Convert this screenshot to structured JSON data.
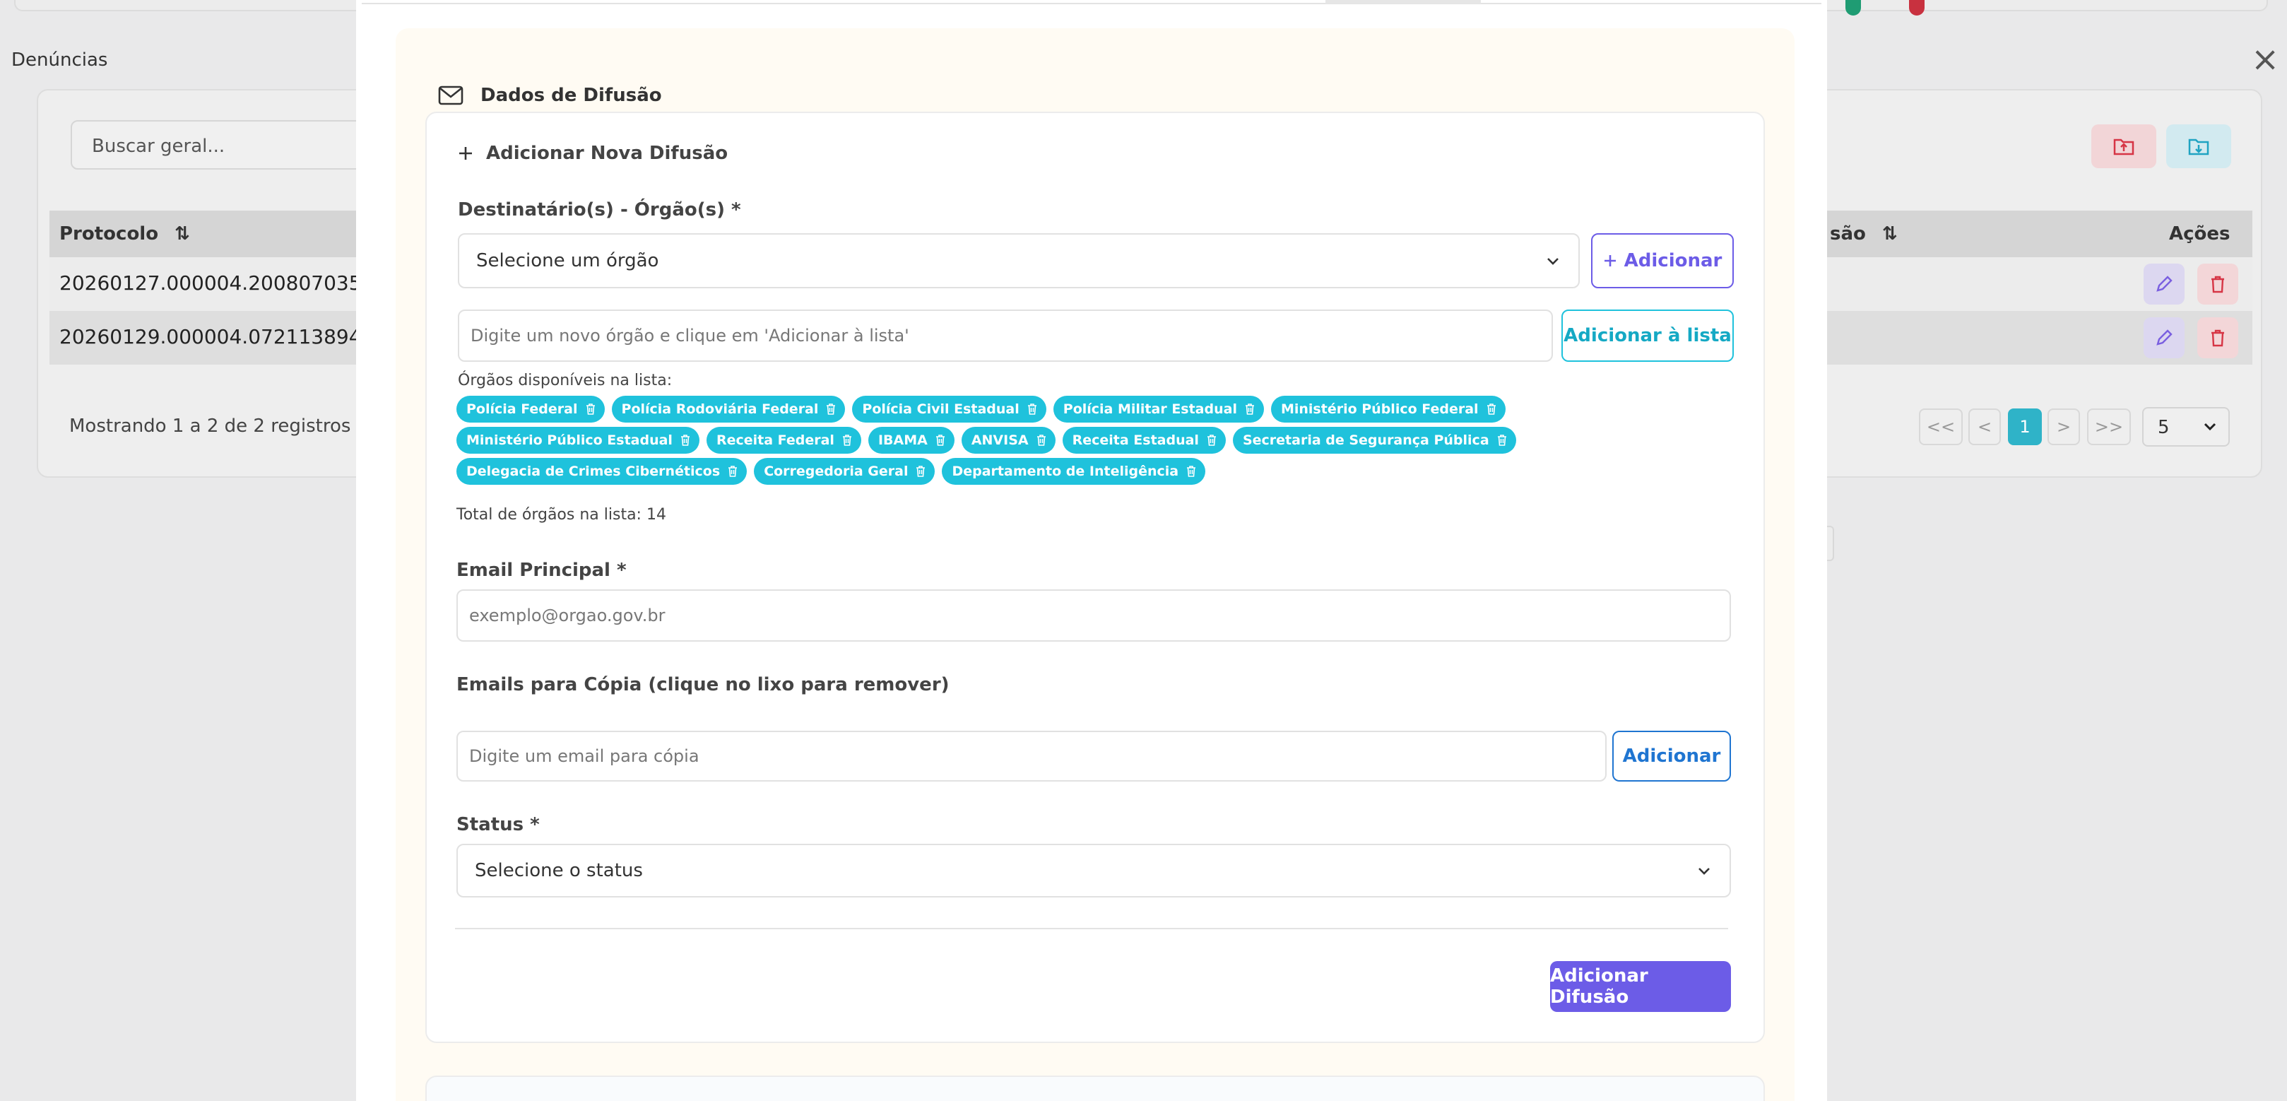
{
  "background": {
    "page_title": "Denúncias",
    "search_placeholder": "Buscar geral...",
    "table": {
      "columns": [
        "Protocolo",
        "são",
        "Ações"
      ],
      "rows": [
        {
          "protocolo": "20260127.000004.200807035"
        },
        {
          "protocolo": "20260129.000004.072113894"
        }
      ]
    },
    "showing": "Mostrando 1 a 2 de 2 registros",
    "pagination": [
      "<<",
      "<",
      "1",
      ">",
      ">>"
    ],
    "page_size": "5"
  },
  "modal": {
    "section_title": "Dados de Difusão",
    "add_new": "Adicionar Nova Difusão",
    "recipients_label": "Destinatário(s) - Órgão(s) *",
    "recipients_select": "Selecione um órgão",
    "add_button": "Adicionar",
    "new_org_placeholder": "Digite um novo órgão e clique em 'Adicionar à lista'",
    "add_to_list_button": "Adicionar à lista",
    "available_label": "Órgãos disponíveis na lista:",
    "orgs": [
      "Polícia Federal",
      "Polícia Rodoviária Federal",
      "Polícia Civil Estadual",
      "Polícia Militar Estadual",
      "Ministério Público Federal",
      "Ministério Público Estadual",
      "Receita Federal",
      "IBAMA",
      "ANVISA",
      "Receita Estadual",
      "Secretaria de Segurança Pública",
      "Delegacia de Crimes Cibernéticos",
      "Corregedoria Geral",
      "Departamento de Inteligência"
    ],
    "total_label": "Total de órgãos na lista: 14",
    "email_label": "Email Principal *",
    "email_placeholder": "exemplo@orgao.gov.br",
    "cc_label": "Emails para Cópia (clique no lixo para remover)",
    "cc_placeholder": "Digite um email para cópia",
    "cc_add_button": "Adicionar",
    "status_label": "Status *",
    "status_select": "Selecione o status",
    "submit_button": "Adicionar Difusão"
  },
  "colors": {
    "primary": "#6c5ce7",
    "cyan": "#1fc2dc",
    "link_blue": "#1f75d1",
    "danger": "#d63545"
  }
}
